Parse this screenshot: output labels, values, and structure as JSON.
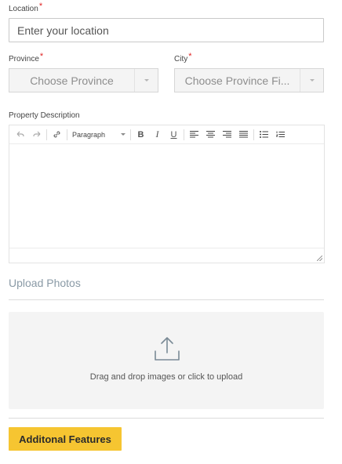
{
  "location": {
    "label": "Location",
    "required_mark": "*",
    "placeholder": "Enter your location"
  },
  "province": {
    "label": "Province",
    "required_mark": "*",
    "selected": "Choose Province"
  },
  "city": {
    "label": "City",
    "required_mark": "*",
    "selected": "Choose Province Fi..."
  },
  "description": {
    "label": "Property Description",
    "toolbar": {
      "format_select": "Paragraph",
      "bold": "B",
      "italic": "I",
      "underline": "U"
    }
  },
  "upload": {
    "title": "Upload Photos",
    "dropzone_text": "Drag and drop images or click to upload"
  },
  "actions": {
    "features_button": "Additonal Features"
  },
  "colors": {
    "accent": "#f6c531",
    "required": "#e02424",
    "section_title": "#8a9aa6"
  }
}
